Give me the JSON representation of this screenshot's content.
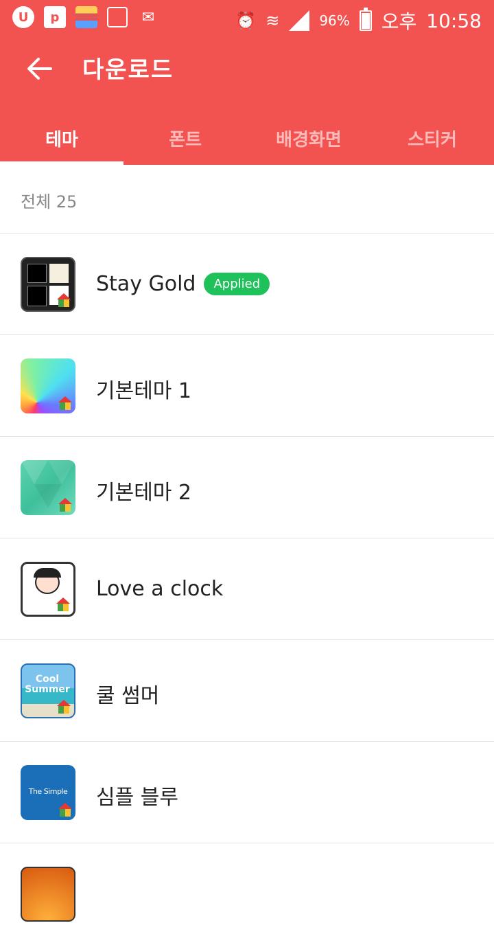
{
  "status": {
    "battery": "96%",
    "ampm": "오후",
    "time": "10:58",
    "battery_level": 0.96
  },
  "appbar": {
    "title": "다운로드"
  },
  "tabs": [
    {
      "label": "테마",
      "active": true
    },
    {
      "label": "폰트",
      "active": false
    },
    {
      "label": "배경화면",
      "active": false
    },
    {
      "label": "스티커",
      "active": false
    }
  ],
  "summary": {
    "count_label": "전체 25"
  },
  "items": [
    {
      "name": "Stay Gold",
      "badge": "Applied"
    },
    {
      "name": "기본테마 1"
    },
    {
      "name": "기본테마 2"
    },
    {
      "name": "Love a clock"
    },
    {
      "name": "쿨 썸머",
      "thumb_text": "Cool Summer"
    },
    {
      "name": "심플 블루",
      "thumb_text": "The Simple"
    }
  ],
  "colors": {
    "accent": "#f25350",
    "applied": "#1fc25a"
  }
}
